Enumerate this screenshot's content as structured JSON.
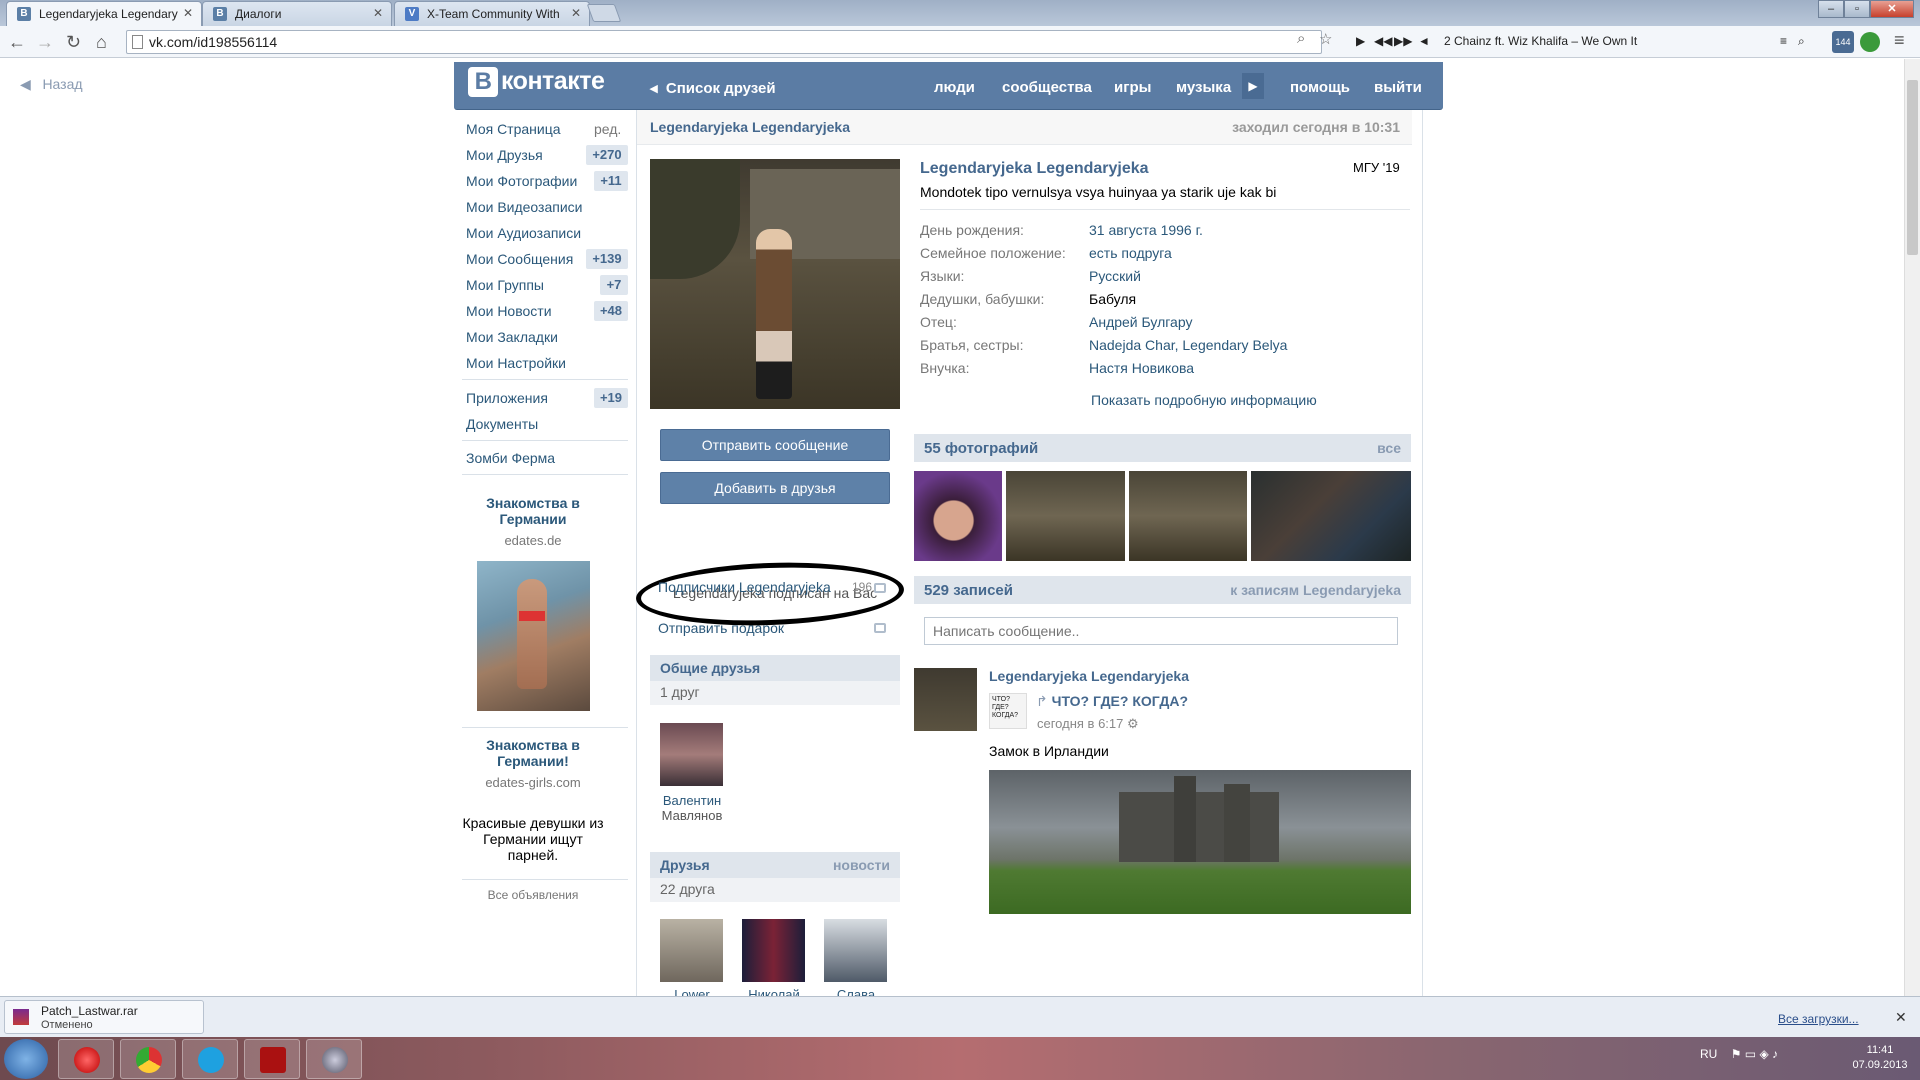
{
  "browser": {
    "tabs": [
      {
        "title": "Legendaryjeka Legendary",
        "favicon": "В"
      },
      {
        "title": "Диалоги",
        "favicon": "В"
      },
      {
        "title": "X-Team Community With",
        "favicon": "V"
      }
    ],
    "url": "vk.com/id198556114",
    "player_track": "2 Chainz ft. Wiz Khalifa – We Own It",
    "badge_count": "144"
  },
  "page": {
    "back": "Назад",
    "header": {
      "logo": "контакте",
      "logo_letter": "В",
      "friends_list": "Список друзей",
      "nav": [
        "люди",
        "сообщества",
        "игры",
        "музыка",
        "помощь",
        "выйти"
      ]
    },
    "left_menu": {
      "items": [
        {
          "label": "Моя Страница",
          "extra": "ред."
        },
        {
          "label": "Мои Друзья",
          "count": "+270"
        },
        {
          "label": "Мои Фотографии",
          "count": "+11"
        },
        {
          "label": "Мои Видеозаписи"
        },
        {
          "label": "Мои Аудиозаписи"
        },
        {
          "label": "Мои Сообщения",
          "count": "+139"
        },
        {
          "label": "Мои Группы",
          "count": "+7"
        },
        {
          "label": "Мои Новости",
          "count": "+48"
        },
        {
          "label": "Мои Закладки"
        },
        {
          "label": "Мои Настройки"
        },
        {
          "label": "Приложения",
          "count": "+19"
        },
        {
          "label": "Документы"
        },
        {
          "label": "Зомби Ферма"
        }
      ],
      "ads": [
        {
          "title": "Знакомства в Германии",
          "domain": "edates.de"
        },
        {
          "title": "Знакомства в Германии!",
          "domain": "edates-girls.com",
          "text": "Красивые девушки из Германии ищут парней."
        }
      ],
      "all_ads": "Все объявления"
    },
    "profile": {
      "name": "Legendaryjeka Legendaryjeka",
      "last_seen": "заходил сегодня в 10:31",
      "university": "МГУ '19",
      "status": "Mondotek tipo vernulsya vsya huinyaa ya starik uje kak bi",
      "info": [
        {
          "label": "День рождения:",
          "value": "31 августа 1996 г."
        },
        {
          "label": "Семейное положение:",
          "value": "есть подруга"
        },
        {
          "label": "Языки:",
          "value": "Русский"
        },
        {
          "label": "Дедушки, бабушки:",
          "value": "Бабуля"
        },
        {
          "label": "Отец:",
          "value": "Андрей Булгару"
        },
        {
          "label": "Братья, сестры:",
          "value": "Nadejda Char, Legendary Belya"
        },
        {
          "label": "Внучка:",
          "value": "Настя Новикова"
        }
      ],
      "more_info": "Показать подробную информацию",
      "send_message": "Отправить сообщение",
      "add_friend": "Добавить в друзья",
      "subscribed": "Legendaryjeka подписан на Вас",
      "followers_label": "Подписчики Legendaryjeka",
      "followers_count": "196",
      "send_gift": "Отправить подарок",
      "common_friends": {
        "title": "Общие друзья",
        "sub": "1 друг",
        "friend_first": "Валентин",
        "friend_last": "Мавлянов"
      },
      "friends": {
        "title": "Друзья",
        "link": "новости",
        "sub": "22 друга",
        "names": [
          "Lower",
          "Николай",
          "Слава"
        ]
      },
      "photos": {
        "title": "55 фотографий",
        "link": "все"
      },
      "wall": {
        "title": "529 записей",
        "link": "к записям Legendaryjeka",
        "placeholder": "Написать сообщение.."
      },
      "post": {
        "author": "Legendaryjeka Legendaryjeka",
        "group": "ЧТО? ГДЕ? КОГДА?",
        "group_logo": "ЧТО? ГДЕ? КОГДА?",
        "time": "сегодня в 6:17",
        "text": "Замок в Ирландии"
      }
    }
  },
  "downloads": {
    "file": "Patch_Lastwar.rar",
    "status": "Отменено",
    "all": "Все загрузки..."
  },
  "system": {
    "lang": "RU",
    "time": "11:41",
    "date": "07.09.2013"
  }
}
